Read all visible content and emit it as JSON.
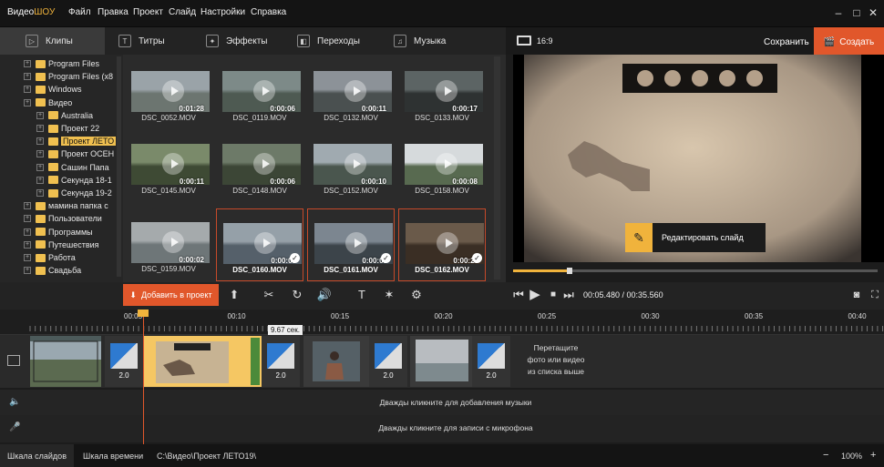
{
  "app": {
    "logo_a": "Видео",
    "logo_b": "ШОУ"
  },
  "menu": [
    "Файл",
    "Правка",
    "Проект",
    "Слайд",
    "Настройки",
    "Справка"
  ],
  "tabs": [
    {
      "label": "Клипы",
      "icon": "clip-icon"
    },
    {
      "label": "Титры",
      "icon": "text-icon"
    },
    {
      "label": "Эффекты",
      "icon": "wand-icon"
    },
    {
      "label": "Переходы",
      "icon": "transition-icon"
    },
    {
      "label": "Музыка",
      "icon": "music-icon"
    }
  ],
  "aspect": "16:9",
  "save_label": "Сохранить",
  "create_label": "Создать",
  "tree": [
    {
      "label": "Program Files",
      "indent": 0
    },
    {
      "label": "Program Files (x8",
      "indent": 0
    },
    {
      "label": "Windows",
      "indent": 0
    },
    {
      "label": "Видео",
      "indent": 0
    },
    {
      "label": "Australia",
      "indent": 1
    },
    {
      "label": "Проект 22",
      "indent": 1
    },
    {
      "label": "Проект ЛЕТО",
      "indent": 1,
      "selected": true
    },
    {
      "label": "Проект ОСЕН",
      "indent": 1
    },
    {
      "label": "Сашин Папа",
      "indent": 1
    },
    {
      "label": "Секунда 18-1",
      "indent": 1
    },
    {
      "label": "Секунда 19-2",
      "indent": 1
    },
    {
      "label": "мамина папка с",
      "indent": 0
    },
    {
      "label": "Пользователи",
      "indent": 0
    },
    {
      "label": "Программы",
      "indent": 0
    },
    {
      "label": "Путешествия",
      "indent": 0
    },
    {
      "label": "Работа",
      "indent": 0
    },
    {
      "label": "Свадьба",
      "indent": 0
    }
  ],
  "clips": [
    {
      "name": "DSC_0052.MOV",
      "dur": "0:01:28"
    },
    {
      "name": "DSC_0119.MOV",
      "dur": "0:00:06"
    },
    {
      "name": "DSC_0132.MOV",
      "dur": "0:00:11"
    },
    {
      "name": "DSC_0133.MOV",
      "dur": "0:00:17"
    },
    {
      "name": "DSC_0145.MOV",
      "dur": "0:00:11"
    },
    {
      "name": "DSC_0148.MOV",
      "dur": "0:00:06"
    },
    {
      "name": "DSC_0152.MOV",
      "dur": "0:00:10"
    },
    {
      "name": "DSC_0158.MOV",
      "dur": "0:00:08"
    },
    {
      "name": "DSC_0159.MOV",
      "dur": "0:00:02"
    },
    {
      "name": "DSC_0160.MOV",
      "dur": "0:00:05",
      "selected": true
    },
    {
      "name": "DSC_0161.MOV",
      "dur": "0:00:08",
      "selected": true
    },
    {
      "name": "DSC_0162.MOV",
      "dur": "0:00:23",
      "selected": true
    }
  ],
  "edit_slide_label": "Редактировать слайд",
  "add_to_project_label": "Добавить в проект",
  "timecode": "00:05.480 / 00:35.560",
  "seek_progress": 0.155,
  "ruler": [
    "00:05",
    "00:10",
    "00:15",
    "00:20",
    "00:25",
    "00:30",
    "00:35",
    "00:40"
  ],
  "tooltip": "9.67 сек.",
  "transitions": [
    "2.0",
    "2.0",
    "2.0",
    "2.0"
  ],
  "drop_hint": [
    "Перетащите",
    "фото или видео",
    "из списка выше"
  ],
  "music_hint": "Дважды кликните для добавления музыки",
  "mic_hint": "Дважды кликните для записи с микрофона",
  "status": {
    "tab_slides": "Шкала слайдов",
    "tab_timeline": "Шкала времени",
    "path": "C:\\Видео\\Проект ЛЕТО19\\",
    "zoom": "100%"
  }
}
